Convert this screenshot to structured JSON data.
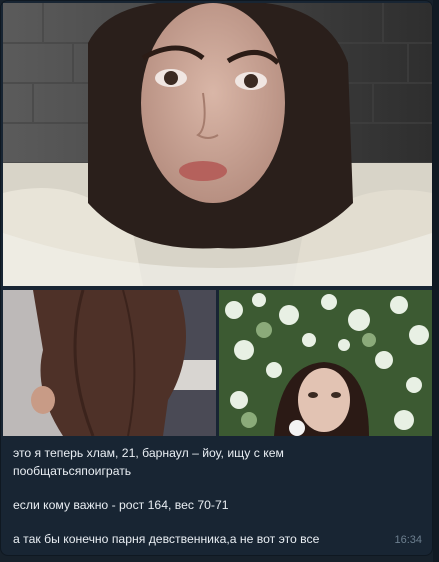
{
  "message": {
    "caption_lines": [
      "это я теперь хлам, 21, барнаул – йоу, ищу с кем пообщатьсяпоиграть",
      "если кому важно - рост 164, вес 70-71",
      "а так бы конечно парня девственника,а не вот это все"
    ],
    "time": "16:34"
  },
  "photos": [
    {
      "subject": "portrait-close-up"
    },
    {
      "subject": "brown-dress-torso"
    },
    {
      "subject": "girl-under-blossoming-tree"
    }
  ]
}
